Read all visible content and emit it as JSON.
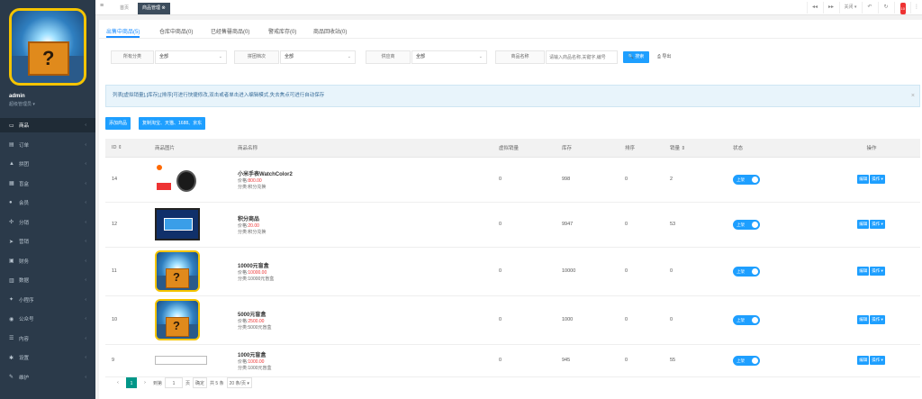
{
  "sidebar": {
    "user_name": "admin",
    "user_role": "超级管理员 ▾",
    "items": [
      {
        "icon": "monitor-icon",
        "glyph": "▭",
        "label": "商品",
        "active": true
      },
      {
        "icon": "order-icon",
        "glyph": "▤",
        "label": "订单"
      },
      {
        "icon": "chart-icon",
        "glyph": "▲",
        "label": "拼团"
      },
      {
        "icon": "blindbox-icon",
        "glyph": "▦",
        "label": "盲盒"
      },
      {
        "icon": "user-icon",
        "glyph": "●",
        "label": "会员"
      },
      {
        "icon": "share-icon",
        "glyph": "✣",
        "label": "分销"
      },
      {
        "icon": "send-icon",
        "glyph": "➤",
        "label": "营销"
      },
      {
        "icon": "finance-icon",
        "glyph": "▣",
        "label": "财务"
      },
      {
        "icon": "data-icon",
        "glyph": "▥",
        "label": "数据"
      },
      {
        "icon": "miniapp-icon",
        "glyph": "✦",
        "label": "小程序"
      },
      {
        "icon": "wechat-icon",
        "glyph": "◉",
        "label": "公众号"
      },
      {
        "icon": "content-icon",
        "glyph": "☰",
        "label": "内容"
      },
      {
        "icon": "settings-icon",
        "glyph": "✱",
        "label": "设置"
      },
      {
        "icon": "maintain-icon",
        "glyph": "✎",
        "label": "维护"
      }
    ]
  },
  "topbar": {
    "home_tab": "首页",
    "goods_tab": "商品管理 ⊗",
    "close_label": "关闭 ▾",
    "badge": "10"
  },
  "tabs": [
    "出售中商品(5)",
    "仓库中商品(0)",
    "已经售罄商品(0)",
    "警戒库存(0)",
    "商品回收站(0)"
  ],
  "filters": {
    "category_label": "所有分类",
    "category_value": "全部",
    "group_label": "拼团档次",
    "group_value": "全部",
    "supplier_label": "供应商",
    "supplier_value": "全部",
    "name_label": "商品名称",
    "search_placeholder": "请输入商品名称,关键字,编号",
    "search_button": "🔍 搜索",
    "export_button": "⎙ 导出"
  },
  "notice": "列表[虚拟销量],[库存],[排序]可进行快捷修改,双击或者单击进入编辑模式,失去焦点可进行自动保存",
  "actions": {
    "add_product": "添加商品",
    "copy_product": "复制淘宝、天猫、1688、京东"
  },
  "table": {
    "headers": [
      "ID ⇕",
      "商品图片",
      "商品名称",
      "虚拟销量",
      "库存",
      "排序",
      "销量 ⇕",
      "状态",
      "操作"
    ],
    "rows": [
      {
        "id": "14",
        "name": "小米手表WatchColor2",
        "price_label": "价格:",
        "price": "800.00",
        "category": "分类:积分兑换",
        "virtual_sales": "0",
        "stock": "998",
        "sort": "0",
        "sales": "2",
        "status": "上架",
        "image": "watch"
      },
      {
        "id": "12",
        "name": "积分商品",
        "price_label": "价格:",
        "price": "20.00",
        "category": "分类:积分兑换",
        "virtual_sales": "0",
        "stock": "9947",
        "sort": "0",
        "sales": "53",
        "status": "上架",
        "image": "box"
      },
      {
        "id": "11",
        "name": "10000元盲盒",
        "price_label": "价格:",
        "price": "10000.00",
        "category": "分类:10000元盲盒",
        "virtual_sales": "0",
        "stock": "10000",
        "sort": "0",
        "sales": "0",
        "status": "上架",
        "image": "mystery"
      },
      {
        "id": "10",
        "name": "5000元盲盒",
        "price_label": "价格:",
        "price": "2500.00",
        "category": "分类:5000元盲盒",
        "virtual_sales": "0",
        "stock": "1000",
        "sort": "0",
        "sales": "0",
        "status": "上架",
        "image": "mystery"
      },
      {
        "id": "9",
        "name": "1000元盲盒",
        "price_label": "价格:",
        "price": "1000.00",
        "category": "分类:1000元盲盒",
        "virtual_sales": "0",
        "stock": "945",
        "sort": "0",
        "sales": "55",
        "status": "上架",
        "image": "broken"
      }
    ],
    "edit_label": "编辑",
    "op_label": "操作 ▾"
  },
  "pager": {
    "current": "1",
    "goto_label": "到第",
    "goto_value": "1",
    "page_unit": "页",
    "confirm": "确定",
    "total": "共 5 条",
    "page_size": "20 条/页 ▾"
  },
  "colors": {
    "accent": "#1e9fff",
    "sidebar": "#2b3a4a",
    "price": "#e33333",
    "pager_active": "#009688"
  }
}
